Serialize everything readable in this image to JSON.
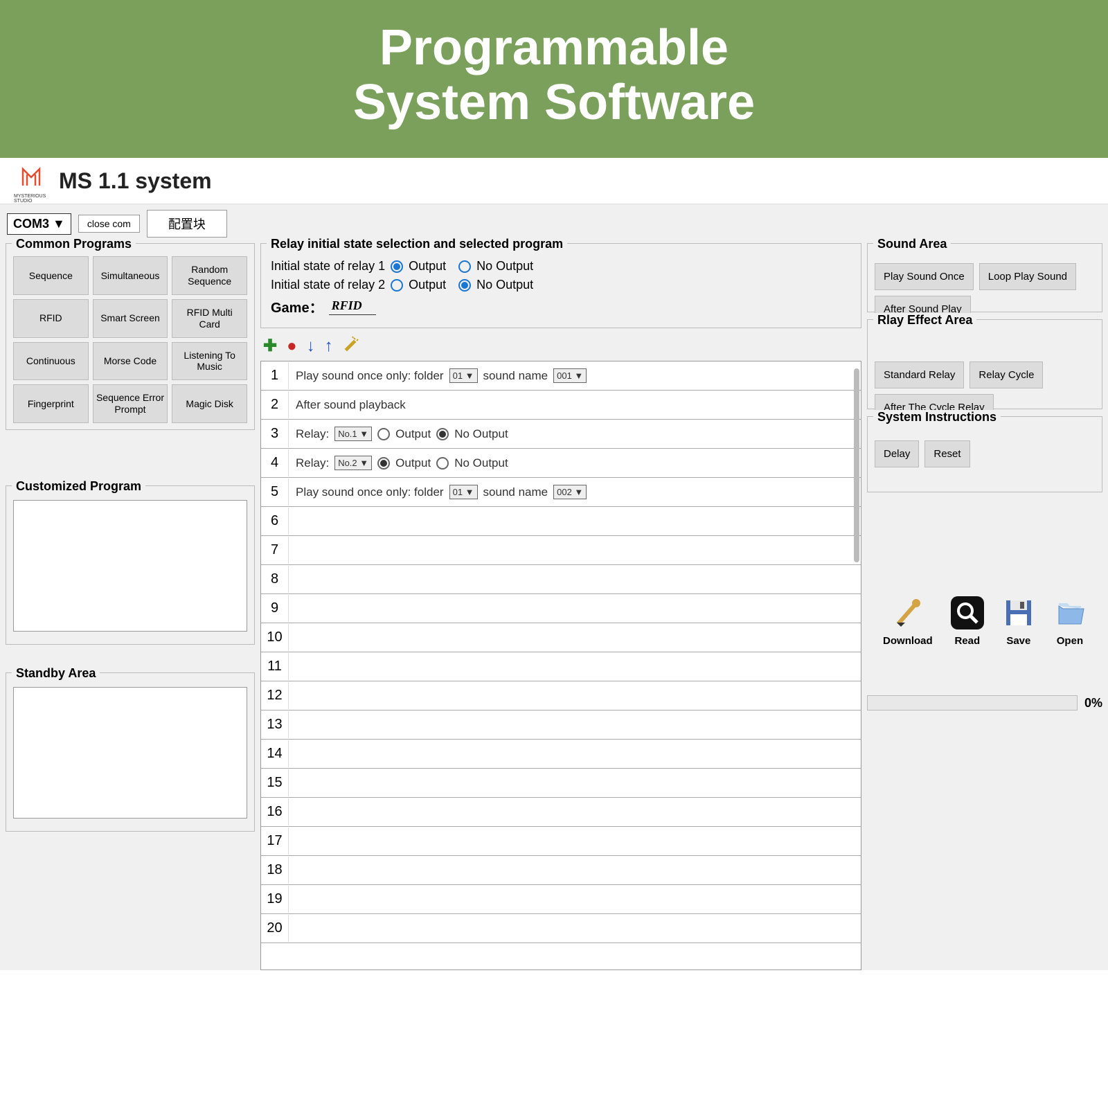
{
  "banner": {
    "line1": "Programmable",
    "line2": "System Software"
  },
  "logo": {
    "brand": "MYSTERIOUS STUDIO"
  },
  "appTitle": "MS 1.1 system",
  "toolbar": {
    "com": "COM3 ▼",
    "closeCom": "close  com",
    "config": "配置块"
  },
  "commonPrograms": {
    "title": "Common Programs",
    "items": [
      "Sequence",
      "Simultaneous",
      "Random Sequence",
      "RFID",
      "Smart Screen",
      "RFID Multi Card",
      "Continuous",
      "Morse Code",
      "Listening To Music",
      "Fingerprint",
      "Sequence Error Prompt",
      "Magic Disk"
    ]
  },
  "customProgram": {
    "title": "Customized Program"
  },
  "standbyArea": {
    "title": "Standby Area"
  },
  "relayPanel": {
    "title": "Relay initial state selection and selected program",
    "relay1Label": "Initial state of relay 1",
    "relay2Label": "Initial state of relay 2",
    "outputLabel": "Output",
    "noOutputLabel": "No Output",
    "gameLabel": "Game：",
    "gameValue": "RFID"
  },
  "steps": {
    "row1": {
      "prefix": "Play sound once only: folder",
      "folder": "01 ▼",
      "mid": "sound name",
      "sound": "001 ▼"
    },
    "row2": {
      "text": "After sound playback"
    },
    "row3": {
      "prefix": "Relay:",
      "sel": "No.1 ▼",
      "out": "Output",
      "noout": "No Output"
    },
    "row4": {
      "prefix": "Relay:",
      "sel": "No.2 ▼",
      "out": "Output",
      "noout": "No Output"
    },
    "row5": {
      "prefix": "Play sound once only: folder",
      "folder": "01 ▼",
      "mid": "sound name",
      "sound": "002 ▼"
    }
  },
  "soundArea": {
    "title": "Sound Area",
    "btns": [
      "Play Sound Once",
      "Loop Play Sound",
      "After Sound Play"
    ]
  },
  "relayEffect": {
    "title": "Rlay Effect Area",
    "btns": [
      "Standard Relay",
      "Relay Cycle",
      "After The Cycle Relay"
    ]
  },
  "sysInstr": {
    "title": "System Instructions",
    "btns": [
      "Delay",
      "Reset"
    ]
  },
  "actions": {
    "download": "Download",
    "read": "Read",
    "save": "Save",
    "open": "Open"
  },
  "progress": {
    "pct": "0%"
  },
  "rowCount": 20
}
